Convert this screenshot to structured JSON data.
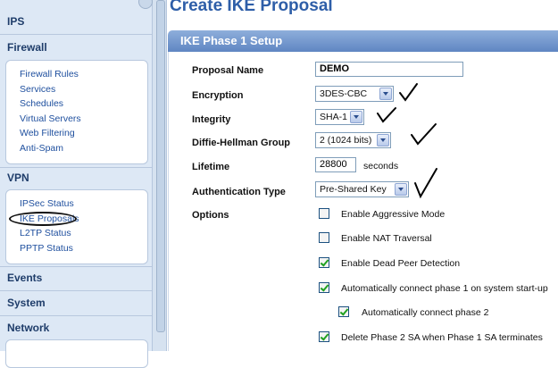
{
  "sidebar": {
    "sections": {
      "ips": "IPS",
      "firewall": "Firewall",
      "vpn": "VPN",
      "events": "Events",
      "system": "System",
      "network": "Network"
    },
    "firewall_items": [
      "Firewall Rules",
      "Services",
      "Schedules",
      "Virtual Servers",
      "Web Filtering",
      "Anti-Spam"
    ],
    "vpn_items": [
      "IPSec Status",
      "IKE Proposals",
      "L2TP Status",
      "PPTP Status"
    ],
    "highlighted_item": "IKE Proposals"
  },
  "page": {
    "title": "Create IKE Proposal",
    "section_title": "IKE Phase 1 Setup"
  },
  "form": {
    "proposal_name": {
      "label": "Proposal Name",
      "value": "DEMO"
    },
    "encryption": {
      "label": "Encryption",
      "value": "3DES-CBC"
    },
    "integrity": {
      "label": "Integrity",
      "value": "SHA-1"
    },
    "dh_group": {
      "label": "Diffie-Hellman Group",
      "value": "2 (1024 bits)"
    },
    "lifetime": {
      "label": "Lifetime",
      "value": "28800",
      "unit": "seconds"
    },
    "auth_type": {
      "label": "Authentication Type",
      "value": "Pre-Shared Key"
    },
    "options": {
      "label": "Options",
      "items": [
        {
          "label": "Enable Aggressive Mode",
          "checked": false
        },
        {
          "label": "Enable NAT Traversal",
          "checked": false
        },
        {
          "label": "Enable Dead Peer Detection",
          "checked": true
        },
        {
          "label": "Automatically connect phase 1 on system start-up",
          "checked": true
        },
        {
          "label": "Automatically connect phase 2",
          "checked": true
        },
        {
          "label": "Delete Phase 2 SA when Phase 1 SA terminates",
          "checked": true
        }
      ]
    }
  },
  "colors": {
    "sidebar_bg": "#dde8f5",
    "section_head": "#1f3d6a",
    "link": "#1e4f9e",
    "title": "#2e5ea8",
    "bar": "#5f86c2",
    "check_green": "#21a121"
  }
}
